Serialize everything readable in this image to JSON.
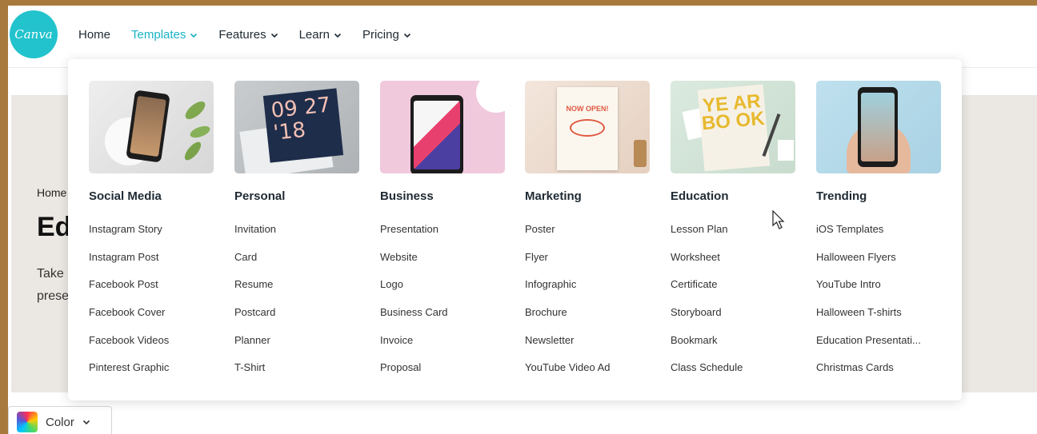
{
  "header": {
    "logo_text": "Canva",
    "nav": [
      {
        "label": "Home",
        "has_caret": false,
        "active": false
      },
      {
        "label": "Templates",
        "has_caret": true,
        "active": true
      },
      {
        "label": "Features",
        "has_caret": true,
        "active": false
      },
      {
        "label": "Learn",
        "has_caret": true,
        "active": false
      },
      {
        "label": "Pricing",
        "has_caret": true,
        "active": false
      }
    ]
  },
  "background_page": {
    "breadcrumb": "Home",
    "title": "Ed",
    "desc_line1": "Take",
    "desc_line2": "prese"
  },
  "color_button": {
    "label": "Color",
    "icon": "color-swatch-icon"
  },
  "dropdown": {
    "columns": [
      {
        "title": "Social Media",
        "thumb": "social-media-thumbnail",
        "links": [
          "Instagram Story",
          "Instagram Post",
          "Facebook Post",
          "Facebook Cover",
          "Facebook Videos",
          "Pinterest Graphic"
        ]
      },
      {
        "title": "Personal",
        "thumb": "personal-thumbnail",
        "links": [
          "Invitation",
          "Card",
          "Resume",
          "Postcard",
          "Planner",
          "T-Shirt"
        ]
      },
      {
        "title": "Business",
        "thumb": "business-thumbnail",
        "links": [
          "Presentation",
          "Website",
          "Logo",
          "Business Card",
          "Invoice",
          "Proposal"
        ]
      },
      {
        "title": "Marketing",
        "thumb": "marketing-thumbnail",
        "links": [
          "Poster",
          "Flyer",
          "Infographic",
          "Brochure",
          "Newsletter",
          "YouTube Video Ad"
        ]
      },
      {
        "title": "Education",
        "thumb": "education-thumbnail",
        "links": [
          "Lesson Plan",
          "Worksheet",
          "Certificate",
          "Storyboard",
          "Bookmark",
          "Class Schedule"
        ]
      },
      {
        "title": "Trending",
        "thumb": "trending-thumbnail",
        "links": [
          "iOS Templates",
          "Halloween Flyers",
          "YouTube Intro",
          "Halloween T-shirts",
          "Education Presentati...",
          "Christmas Cards"
        ]
      }
    ]
  },
  "thumb_text": {
    "personal_card": "09 27\n'18",
    "marketing_poster": "NOW OPEN!",
    "education_yearbook": "YE AR BO OK"
  },
  "colors": {
    "brand": "#22c3cd",
    "active_nav": "#19b3c4",
    "page_border": "#a8793c"
  }
}
